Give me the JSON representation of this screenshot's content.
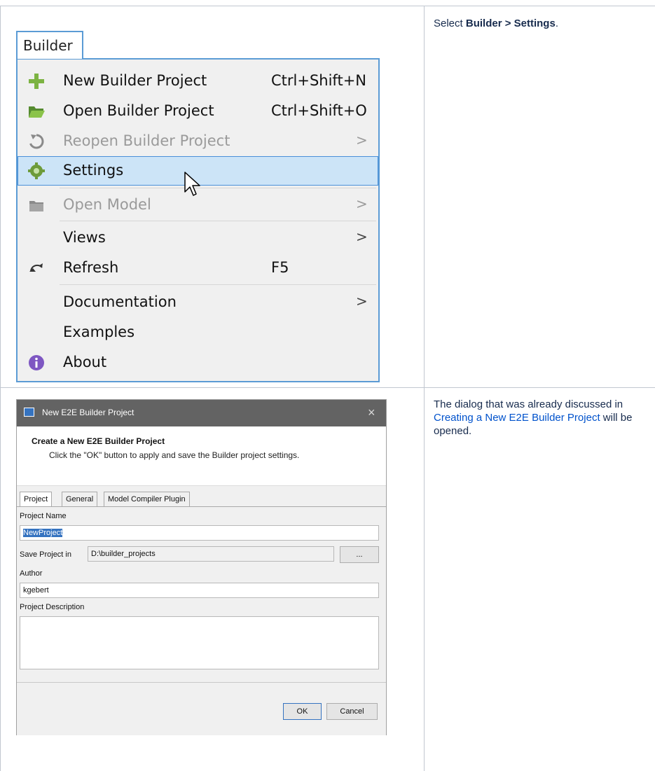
{
  "instructions": {
    "row1": {
      "prefix": "Select ",
      "bold": "Builder > Settings",
      "suffix": "."
    },
    "row2": {
      "prefix": "The dialog that was already discussed in ",
      "link": "Creating a New E2E Builder Project",
      "suffix": " will be opened."
    }
  },
  "menu": {
    "title": "Builder",
    "items": [
      {
        "label": "New Builder Project",
        "shortcut": "Ctrl+Shift+N",
        "icon": "plus-icon",
        "disabled": false
      },
      {
        "label": "Open Builder Project",
        "shortcut": "Ctrl+Shift+O",
        "icon": "folder-open-icon",
        "disabled": false
      },
      {
        "label": "Reopen Builder Project",
        "arrow": ">",
        "icon": "reopen-icon",
        "disabled": true
      },
      {
        "label": "Settings",
        "icon": "gear-icon",
        "disabled": false,
        "highlighted": true
      },
      {
        "label": "Open Model",
        "arrow": ">",
        "icon": "model-icon",
        "disabled": true
      },
      {
        "label": "Views",
        "arrow": ">",
        "disabled": false
      },
      {
        "label": "Refresh",
        "shortcut": "F5",
        "icon": "refresh-icon",
        "disabled": false
      },
      {
        "label": "Documentation",
        "arrow": ">",
        "disabled": false
      },
      {
        "label": "Examples",
        "disabled": false
      },
      {
        "label": "About",
        "icon": "info-icon",
        "disabled": false
      }
    ]
  },
  "dialog": {
    "title": "New E2E Builder Project",
    "close": "×",
    "header_title": "Create a New E2E Builder Project",
    "header_desc": "Click the \"OK\" button to apply and save the Builder project settings.",
    "tabs": [
      "Project",
      "General",
      "Model Compiler Plugin"
    ],
    "fields": {
      "project_name_label": "Project Name",
      "project_name_value": "NewProject",
      "save_in_label": "Save Project in",
      "save_in_value": "D:\\builder_projects",
      "browse_label": "...",
      "author_label": "Author",
      "author_value": "kgebert",
      "description_label": "Project Description",
      "description_value": ""
    },
    "ok_label": "OK",
    "cancel_label": "Cancel"
  },
  "colors": {
    "menu_border": "#5b9bd5",
    "highlight": "#cce4f7",
    "link": "#0052cc",
    "titlebar": "#636363",
    "selection": "#3573c0"
  }
}
